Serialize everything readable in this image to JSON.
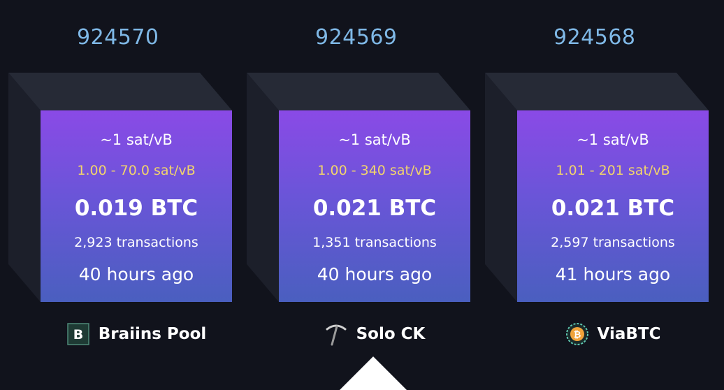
{
  "blocks": [
    {
      "height": "924570",
      "median_fee": "~1 sat/vB",
      "fee_range": "1.00 - 70.0 sat/vB",
      "reward": "0.019 BTC",
      "tx_count": "2,923 transactions",
      "time_ago": "40 hours ago",
      "miner": "Braiins Pool",
      "miner_icon": "braiins-logo-icon"
    },
    {
      "height": "924569",
      "median_fee": "~1 sat/vB",
      "fee_range": "1.00 - 340 sat/vB",
      "reward": "0.021 BTC",
      "tx_count": "1,351 transactions",
      "time_ago": "40 hours ago",
      "miner": "Solo CK",
      "miner_icon": "pickaxe-icon"
    },
    {
      "height": "924568",
      "median_fee": "~1 sat/vB",
      "fee_range": "1.01 - 201 sat/vB",
      "reward": "0.021 BTC",
      "tx_count": "2,597 transactions",
      "time_ago": "41 hours ago",
      "miner": "ViaBTC",
      "miner_icon": "viabtc-logo-icon"
    }
  ],
  "braiins_logo_letter": "B",
  "viabtc_logo_symbol": "₿",
  "colors": {
    "background": "#11131c",
    "height_link": "#7fb8e6",
    "fee_range": "#f2d46b",
    "face_top": "#8a4ae6",
    "face_bottom": "#4a5fbf"
  }
}
